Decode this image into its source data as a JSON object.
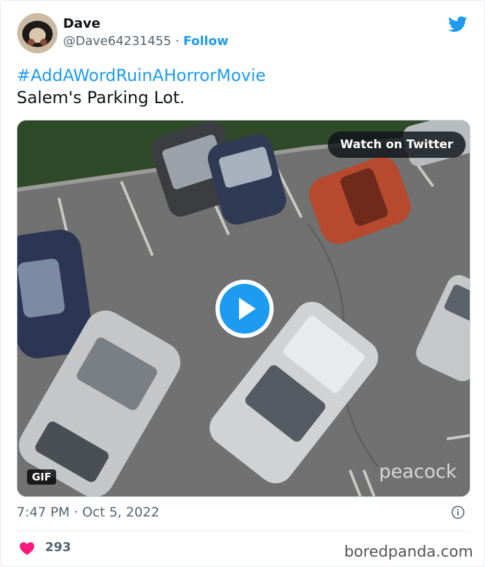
{
  "author": {
    "name": "Dave",
    "handle": "@Dave64231455",
    "separator": "·",
    "follow_label": "Follow"
  },
  "tweet": {
    "hashtag": "#AddAWordRuinAHorrorMovie",
    "text": "Salem's Parking Lot."
  },
  "media": {
    "watch_label": "Watch on Twitter",
    "gif_label": "GIF",
    "watermark": "peacock"
  },
  "meta": {
    "time": "7:47 PM · Oct 5, 2022",
    "likes": "293"
  },
  "footer": {
    "brand": "boredpanda.com"
  },
  "colors": {
    "twitter_blue": "#1d9bf0",
    "heart_red": "#f91880",
    "muted_text": "#536471"
  }
}
